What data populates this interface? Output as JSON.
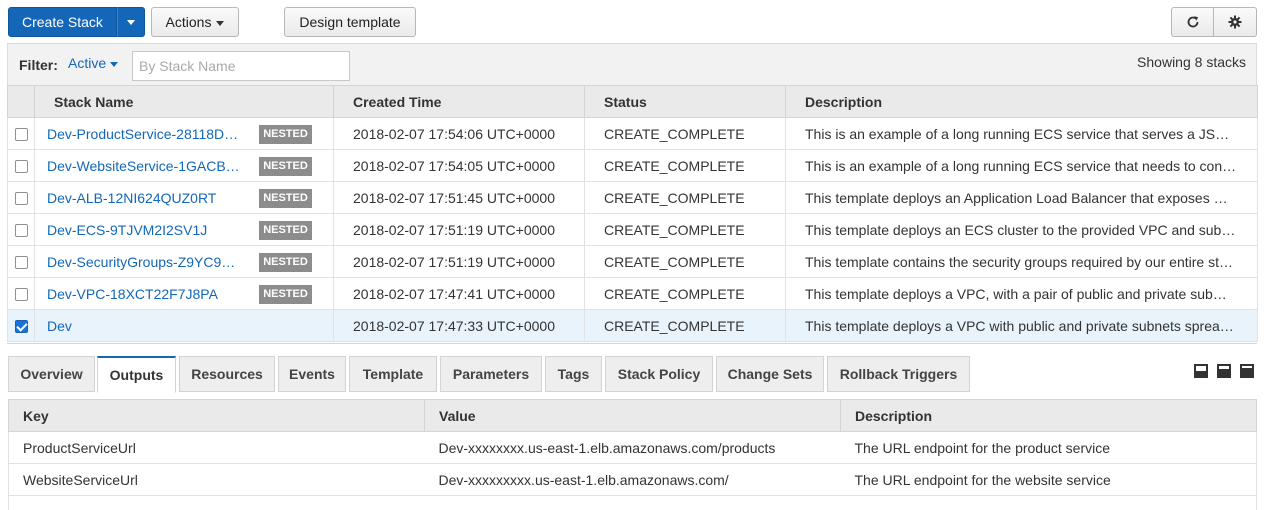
{
  "toolbar": {
    "create_stack_label": "Create Stack",
    "actions_label": "Actions",
    "design_template_label": "Design template"
  },
  "filter": {
    "label": "Filter:",
    "active_label": "Active",
    "search_placeholder": "By Stack Name",
    "showing_text": "Showing 8 stacks"
  },
  "stacks": {
    "columns": [
      "Stack Name",
      "Created Time",
      "Status",
      "Description"
    ],
    "nested_badge": "NESTED",
    "rows": [
      {
        "name": "Dev-ProductService-28118D…",
        "created": "2018-02-07 17:54:06 UTC+0000",
        "status": "CREATE_COMPLETE",
        "description": "This is an example of a long running ECS service that serves a JS…",
        "nested": true,
        "checked": false
      },
      {
        "name": "Dev-WebsiteService-1GACB…",
        "created": "2018-02-07 17:54:05 UTC+0000",
        "status": "CREATE_COMPLETE",
        "description": "This is an example of a long running ECS service that needs to con…",
        "nested": true,
        "checked": false
      },
      {
        "name": "Dev-ALB-12NI624QUZ0RT",
        "created": "2018-02-07 17:51:45 UTC+0000",
        "status": "CREATE_COMPLETE",
        "description": "This template deploys an Application Load Balancer that exposes …",
        "nested": true,
        "checked": false
      },
      {
        "name": "Dev-ECS-9TJVM2I2SV1J",
        "created": "2018-02-07 17:51:19 UTC+0000",
        "status": "CREATE_COMPLETE",
        "description": "This template deploys an ECS cluster to the provided VPC and sub…",
        "nested": true,
        "checked": false
      },
      {
        "name": "Dev-SecurityGroups-Z9YC9G…",
        "created": "2018-02-07 17:51:19 UTC+0000",
        "status": "CREATE_COMPLETE",
        "description": "This template contains the security groups required by our entire st…",
        "nested": true,
        "checked": false
      },
      {
        "name": "Dev-VPC-18XCT22F7J8PA",
        "created": "2018-02-07 17:47:41 UTC+0000",
        "status": "CREATE_COMPLETE",
        "description": "This template deploys a VPC, with a pair of public and private sub…",
        "nested": true,
        "checked": false
      },
      {
        "name": "Dev",
        "created": "2018-02-07 17:47:33 UTC+0000",
        "status": "CREATE_COMPLETE",
        "description": "This template deploys a VPC with public and private subnets sprea…",
        "nested": false,
        "checked": true
      }
    ]
  },
  "tabs": [
    {
      "label": "Overview",
      "active": false
    },
    {
      "label": "Outputs",
      "active": true
    },
    {
      "label": "Resources",
      "active": false
    },
    {
      "label": "Events",
      "active": false
    },
    {
      "label": "Template",
      "active": false
    },
    {
      "label": "Parameters",
      "active": false
    },
    {
      "label": "Tags",
      "active": false
    },
    {
      "label": "Stack Policy",
      "active": false
    },
    {
      "label": "Change Sets",
      "active": false
    },
    {
      "label": "Rollback Triggers",
      "active": false
    }
  ],
  "outputs": {
    "columns": [
      "Key",
      "Value",
      "Description"
    ],
    "rows": [
      {
        "key": "ProductServiceUrl",
        "value": "Dev-xxxxxxxx.us-east-1.elb.amazonaws.com/products",
        "description": "The URL endpoint for the product service"
      },
      {
        "key": "WebsiteServiceUrl",
        "value": "Dev-xxxxxxxxx.us-east-1.elb.amazonaws.com/",
        "description": "The URL endpoint for the website service"
      }
    ]
  },
  "icons": {
    "refresh": "refresh-icon",
    "settings": "gear-icon",
    "views": [
      "panel-small-icon",
      "panel-medium-icon",
      "panel-full-icon"
    ]
  },
  "colors": {
    "primary": "#1467b8",
    "link": "#1467b8",
    "status_complete": "#1d8102",
    "nested_badge": "#8c8c8c",
    "selected_row": "#e9f3fc"
  }
}
